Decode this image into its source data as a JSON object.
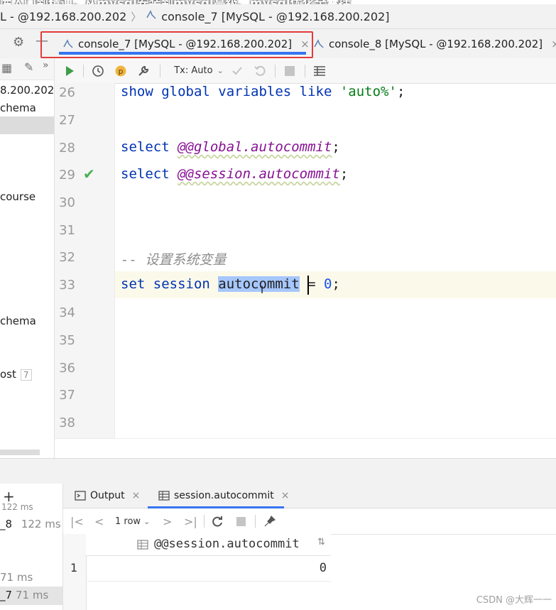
{
  "overlay_title": "库入门到精通，从mysql安装到mysql高级、mysql优化全囊括",
  "breadcrumb": {
    "items": [
      "L - @192.168.200.202",
      "console_7 [MySQL - @192.168.200.202]"
    ]
  },
  "tabs": [
    {
      "label": "console_7 [MySQL - @192.168.200.202]",
      "active": true
    },
    {
      "label": "console_8 [MySQL - @192.168.200.202]",
      "active": false
    }
  ],
  "tabbar": {
    "close_glyph": "×"
  },
  "left_panel": {
    "host": "8.200.202",
    "items": [
      "chema",
      "course",
      "chema",
      "ost"
    ],
    "badge": "7"
  },
  "toolbar": {
    "tx_label": "Tx: Auto",
    "icons": [
      "run-icon",
      "history-icon",
      "explain-icon",
      "settings-wrench-icon",
      "commit-icon",
      "rollback-icon",
      "stop-icon",
      "grid-icon"
    ]
  },
  "editor": {
    "line_numbers": [
      "26",
      "27",
      "28",
      "29",
      "30",
      "31",
      "32",
      "33",
      "34",
      "35",
      "36",
      "37",
      "38"
    ],
    "line26": {
      "kw": "show global variables like ",
      "str": "'auto%'",
      "end": ";"
    },
    "line28": {
      "kw": "select ",
      "var": "@@global.autocommit",
      "end": ";"
    },
    "line29": {
      "kw": "select ",
      "var": "@@session.autocommit",
      "end": ";"
    },
    "line32": {
      "comment": "-- 设置系统变量"
    },
    "line33": {
      "kw": "set session ",
      "sel": "autocommit",
      "mid": " = ",
      "num": "0",
      "end": ";"
    },
    "success_mark": "✔"
  },
  "services": {
    "items": [
      {
        "name": "_8",
        "time": "122 ms"
      },
      {
        "name": "_7",
        "time": "71 ms"
      }
    ],
    "partial_time": "122 ms",
    "partial_time2": "71 ms",
    "add_glyph": "+"
  },
  "result_tabs": [
    {
      "label": "Output"
    },
    {
      "label": "session.autocommit"
    }
  ],
  "result_toolbar": {
    "rows_label": "1 row"
  },
  "grid": {
    "column": "@@session.autocommit",
    "rows": [
      {
        "num": "1",
        "value": "0"
      }
    ]
  },
  "watermark": "CSDN @大辉一一",
  "colors": {
    "accent": "#3574f0",
    "highlight_box": "#e33b3b",
    "keyword": "#0033b3",
    "string": "#067d17",
    "success": "#4caf50"
  }
}
